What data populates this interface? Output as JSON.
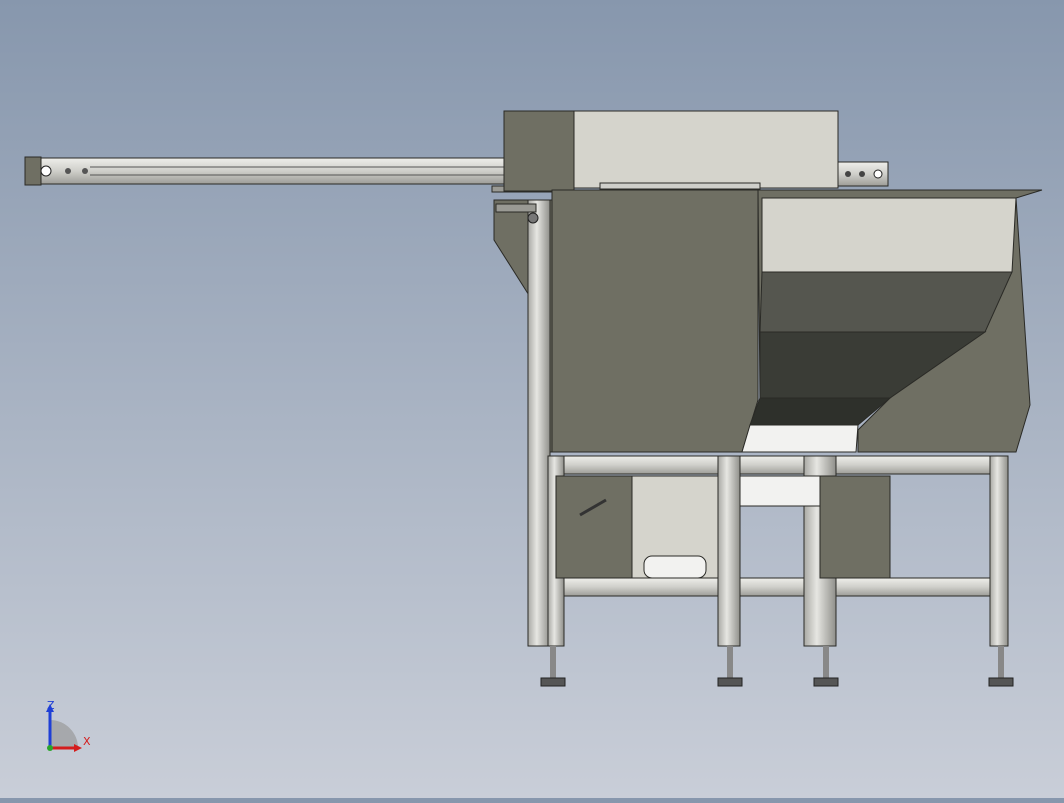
{
  "viewport": {
    "background_top": "#8797ad",
    "background_bottom": "#c9ced8",
    "model": {
      "description_colors": {
        "panel_dark": "#6f6f63",
        "panel_light": "#d5d4cc",
        "frame_aluminum": "#d7d7d3",
        "hopper_inner_dark": "#3a3c36",
        "hopper_inner_mid": "#55564f",
        "edge": "#2a2a26"
      }
    }
  },
  "triad": {
    "z_label": "Z",
    "x_label": "X",
    "z_color": "#1f3fd6",
    "x_color": "#d41c1c",
    "y_color": "#2aa52a"
  }
}
